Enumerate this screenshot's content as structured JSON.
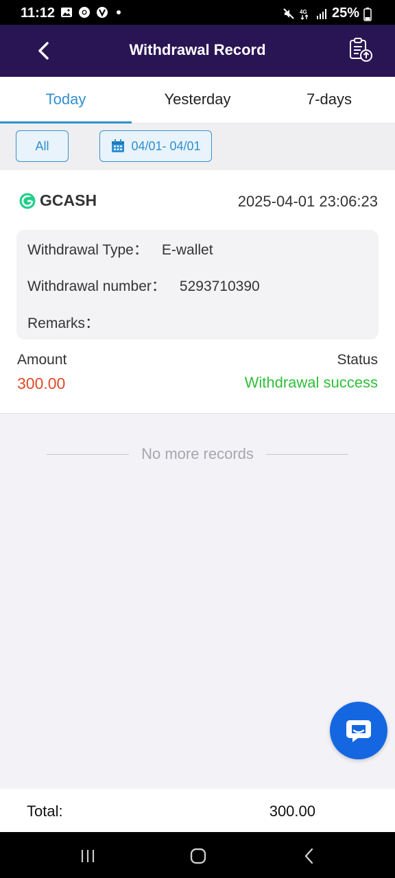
{
  "status_bar": {
    "time": "11:12",
    "battery": "25%",
    "network": "4G",
    "icons": [
      "gallery-icon",
      "chrome-icon",
      "v-app-icon",
      "notification-dot-icon",
      "mute-icon",
      "network-4g-icon",
      "signal-icon",
      "battery-icon"
    ]
  },
  "header": {
    "title": "Withdrawal Record",
    "back_icon": "chevron-left-icon",
    "action_icon": "clipboard-upload-icon"
  },
  "tabs": [
    {
      "label": "Today",
      "active": true
    },
    {
      "label": "Yesterday",
      "active": false
    },
    {
      "label": "7-days",
      "active": false
    }
  ],
  "filters": {
    "type_label": "All",
    "date_range": "04/01- 04/01",
    "date_icon": "calendar-icon"
  },
  "record": {
    "provider": "GCASH",
    "datetime": "2025-04-01 23:06:23",
    "type_label": "Withdrawal Type：",
    "type_value": "E-wallet",
    "number_label": "Withdrawal number：",
    "number_value": "5293710390",
    "remarks_label": "Remarks：",
    "remarks_value": "",
    "amount_label": "Amount",
    "amount_value": "300.00",
    "status_label": "Status",
    "status_value": "Withdrawal success"
  },
  "end_of_list": "No more records",
  "total": {
    "label": "Total:",
    "value": "300.00"
  },
  "colors": {
    "header_bg": "#2a1554",
    "accent": "#2f8fd0",
    "amount": "#e04a2a",
    "success": "#2fbf3a",
    "fab": "#1467e0"
  }
}
